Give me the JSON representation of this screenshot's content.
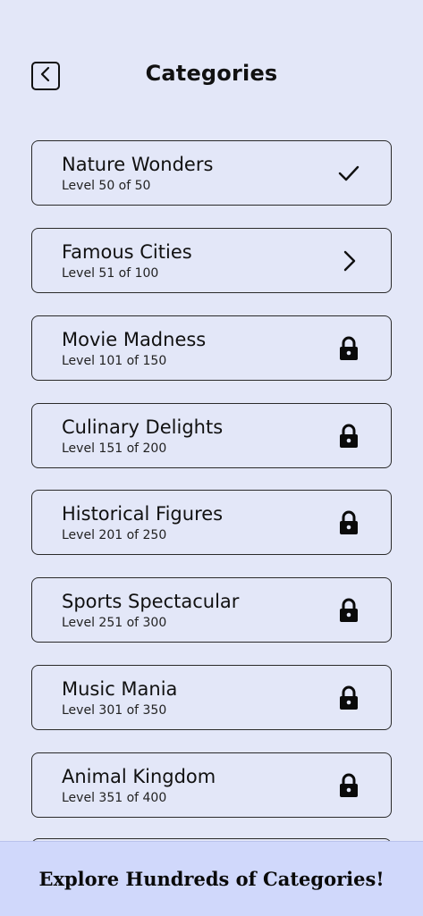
{
  "header": {
    "title": "Categories",
    "back_icon": "chevron-left-icon"
  },
  "categories": [
    {
      "name": "Nature Wonders",
      "level": "Level 50 of 50",
      "status": "completed",
      "icon": "check-icon"
    },
    {
      "name": "Famous Cities",
      "level": "Level 51 of 100",
      "status": "current",
      "icon": "chevron-right-icon"
    },
    {
      "name": "Movie Madness",
      "level": "Level 101 of 150",
      "status": "locked",
      "icon": "lock-icon"
    },
    {
      "name": "Culinary Delights",
      "level": "Level 151 of 200",
      "status": "locked",
      "icon": "lock-icon"
    },
    {
      "name": "Historical Figures",
      "level": "Level 201 of 250",
      "status": "locked",
      "icon": "lock-icon"
    },
    {
      "name": "Sports Spectacular",
      "level": "Level 251 of 300",
      "status": "locked",
      "icon": "lock-icon"
    },
    {
      "name": "Music Mania",
      "level": "Level 301 of 350",
      "status": "locked",
      "icon": "lock-icon"
    },
    {
      "name": "Animal Kingdom",
      "level": "Level 351 of 400",
      "status": "locked",
      "icon": "lock-icon"
    }
  ],
  "banner": {
    "text": "Explore Hundreds of Categories!"
  },
  "colors": {
    "background": "#e3e7f8",
    "banner_background": "#d0d8fb",
    "text": "#111111"
  }
}
